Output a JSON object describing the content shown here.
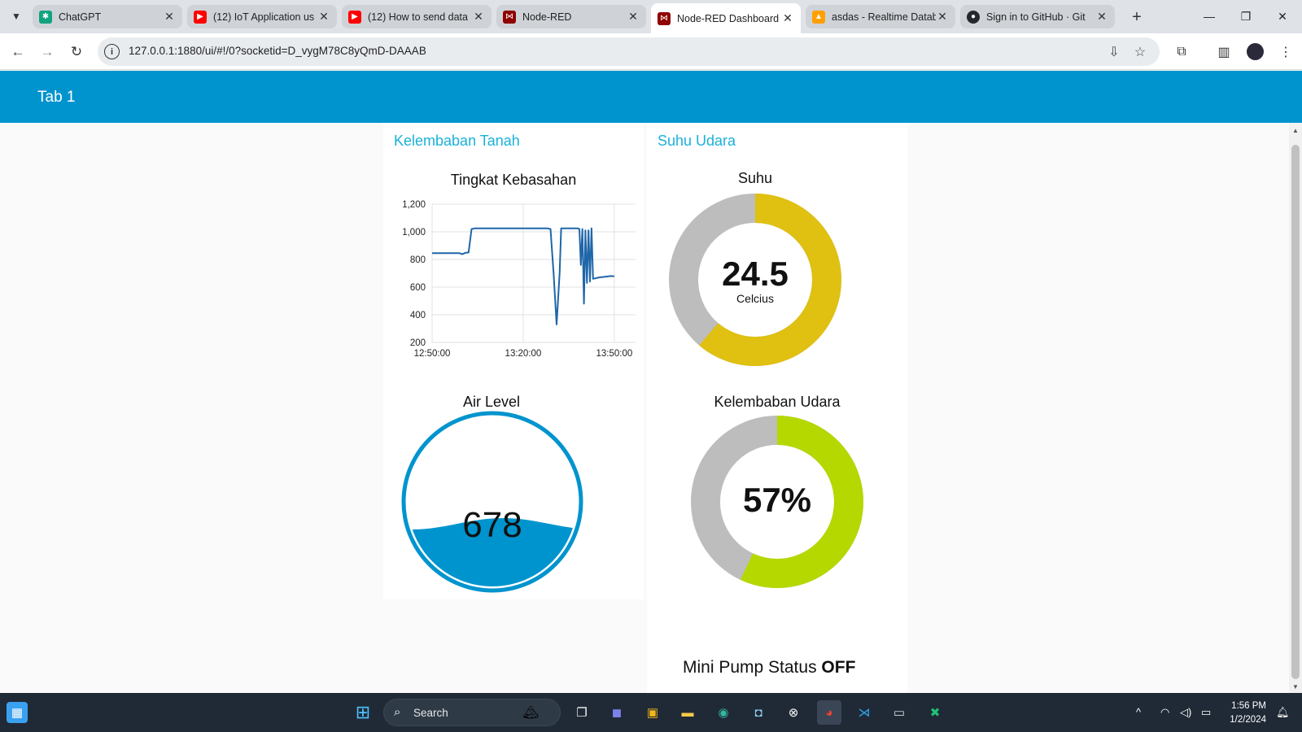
{
  "browser": {
    "tabs": [
      {
        "title": "ChatGPT",
        "favicon": "chatgpt-icon",
        "color": "#10a37f"
      },
      {
        "title": "(12) IoT Application us",
        "favicon": "youtube-icon",
        "color": "#ff0000"
      },
      {
        "title": "(12) How to send data",
        "favicon": "youtube-icon",
        "color": "#ff0000"
      },
      {
        "title": "Node-RED",
        "favicon": "node-red-icon",
        "color": "#8f0000"
      },
      {
        "title": "Node-RED Dashboard",
        "favicon": "node-red-dashboard-icon",
        "color": "#8f0000",
        "active": true
      },
      {
        "title": "asdas - Realtime Datab",
        "favicon": "firebase-icon",
        "color": "#ffa000"
      },
      {
        "title": "Sign in to GitHub · Git",
        "favicon": "github-icon",
        "color": "#24292f"
      }
    ],
    "url": "127.0.0.1:1880/ui/#!/0?socketid=D_vygM78C8yQmD-DAAAB"
  },
  "dashboard": {
    "header_title": "Tab 1",
    "accent_color": "#0094ce",
    "group_left_title": "Kelembaban Tanah",
    "group_right_title": "Suhu Udara",
    "soil_chart_title": "Tingkat Kebasahan",
    "water_title": "Air Level",
    "water_value": "678",
    "temp_title": "Suhu",
    "temp_value": "24.5",
    "temp_unit": "Celcius",
    "temp_color": "#e0c010",
    "humidity_title": "Kelembaban Udara",
    "humidity_value": "57%",
    "humidity_color": "#b4d800",
    "pump_label": "Mini Pump Status",
    "pump_state": "OFF"
  },
  "gauges": {
    "temp": {
      "value": 24.5,
      "min": 0,
      "max": 40
    },
    "humidity": {
      "value": 57,
      "min": 0,
      "max": 100
    },
    "water": {
      "fill_fraction": 0.37
    }
  },
  "chart_data": {
    "type": "line",
    "title": "Tingkat Kebasahan",
    "xlabel": "",
    "ylabel": "",
    "x_ticks": [
      "12:50:00",
      "13:20:00",
      "13:50:00"
    ],
    "y_ticks": [
      "1,200",
      "1,000",
      "800",
      "600",
      "400",
      "200"
    ],
    "ylim": [
      200,
      1200
    ],
    "x_range_minutes": [
      0,
      67
    ],
    "series": [
      {
        "color": "#1f66a8",
        "points": [
          [
            0,
            845
          ],
          [
            9,
            845
          ],
          [
            10,
            838
          ],
          [
            11,
            848
          ],
          [
            12,
            850
          ],
          [
            13,
            1020
          ],
          [
            14,
            1025
          ],
          [
            38,
            1025
          ],
          [
            39,
            1020
          ],
          [
            40,
            700
          ],
          [
            41,
            330
          ],
          [
            42,
            700
          ],
          [
            42.5,
            1025
          ],
          [
            48,
            1025
          ],
          [
            48.5,
            1020
          ],
          [
            49,
            760
          ],
          [
            49.5,
            1020
          ],
          [
            50,
            480
          ],
          [
            50.5,
            1010
          ],
          [
            51,
            630
          ],
          [
            51.5,
            1010
          ],
          [
            52,
            640
          ],
          [
            52.5,
            1025
          ],
          [
            53,
            660
          ],
          [
            55,
            670
          ],
          [
            57,
            675
          ],
          [
            59,
            680
          ],
          [
            60,
            678
          ]
        ]
      }
    ]
  },
  "taskbar": {
    "search_label": "Search",
    "time": "1:56 PM",
    "date": "1/2/2024"
  }
}
